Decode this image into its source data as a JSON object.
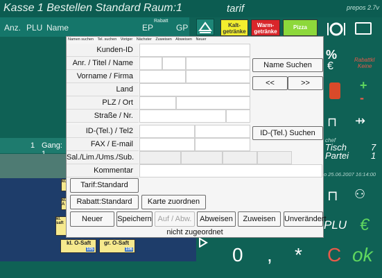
{
  "window": {
    "title": "Kasse 1 Bestellen Standard Raum:1",
    "mode": "tarif",
    "version": "prepos 2.7v"
  },
  "order_header": {
    "anz": "Anz.",
    "plu": "PLU",
    "name": "Name",
    "ep": "EP",
    "rabatt": "Rabatt",
    "gp": "GP"
  },
  "categories": [
    {
      "label": "Kalt-\ngetränke",
      "color": "#f2ee2e"
    },
    {
      "label": "Warm-\ngetränke",
      "color": "#d9262a"
    },
    {
      "label": "Pizza",
      "color": "#8dd83b"
    }
  ],
  "order_row": {
    "qty": "1",
    "label": "Gang: 1"
  },
  "side": {
    "percent": "%",
    "euro": "€",
    "rabattkl": "Rabattkl",
    "keine": "Keine",
    "chef": "chef",
    "tisch": "Tisch",
    "tisch_no": "7",
    "partei": "Partei",
    "partei_no": "1",
    "datetime": "o 25.06.2007 16:14:00",
    "plu": "PLU",
    "plus": "+",
    "minus": "-"
  },
  "products": [
    {
      "label": "kl.",
      "sub": ""
    },
    {
      "label": "kl. A",
      "sub": ""
    },
    {
      "label": "kl.",
      "sub": "saft"
    },
    {
      "label": "kl. O-Saft",
      "sub": "105"
    },
    {
      "label": "gr. O-Saft",
      "sub": "106"
    }
  ],
  "keypad": {
    "zero": "0",
    "comma": ",",
    "mult": "*",
    "c": "C",
    "ok": "ok"
  },
  "dialog": {
    "menu": [
      "Namen suchen",
      "Tel. suchen",
      "Voriger",
      "Nächster",
      "Zuweisen",
      "Abweisen",
      "Neuer"
    ],
    "labels": {
      "kunden_id": "Kunden-ID",
      "anrede": "Anr. / Titel / Name",
      "vorname": "Vorname / Firma",
      "land": "Land",
      "plz": "PLZ / Ort",
      "strasse": "Straße / Nr.",
      "tel": "ID-(Tel.) / Tel2",
      "fax": "FAX / E-mail",
      "sal": "Sal./Lim./Ums./Sub.",
      "kommentar": "Kommentar"
    },
    "buttons": {
      "name_suchen": "Name Suchen",
      "prev": "<<",
      "next": ">>",
      "tel_suchen": "ID-(Tel.) Suchen",
      "tarif": "Tarif:Standard",
      "rabatt": "Rabatt:Standard",
      "karte": "Karte zuordnen",
      "neuer": "Neuer",
      "speichern": "Speichern",
      "auf_abw": "Auf / Abw.",
      "abweisen": "Abweisen",
      "zuweisen": "Zuweisen",
      "unveraendert": "Unverändert"
    },
    "status": "nicht zugeordnet"
  }
}
